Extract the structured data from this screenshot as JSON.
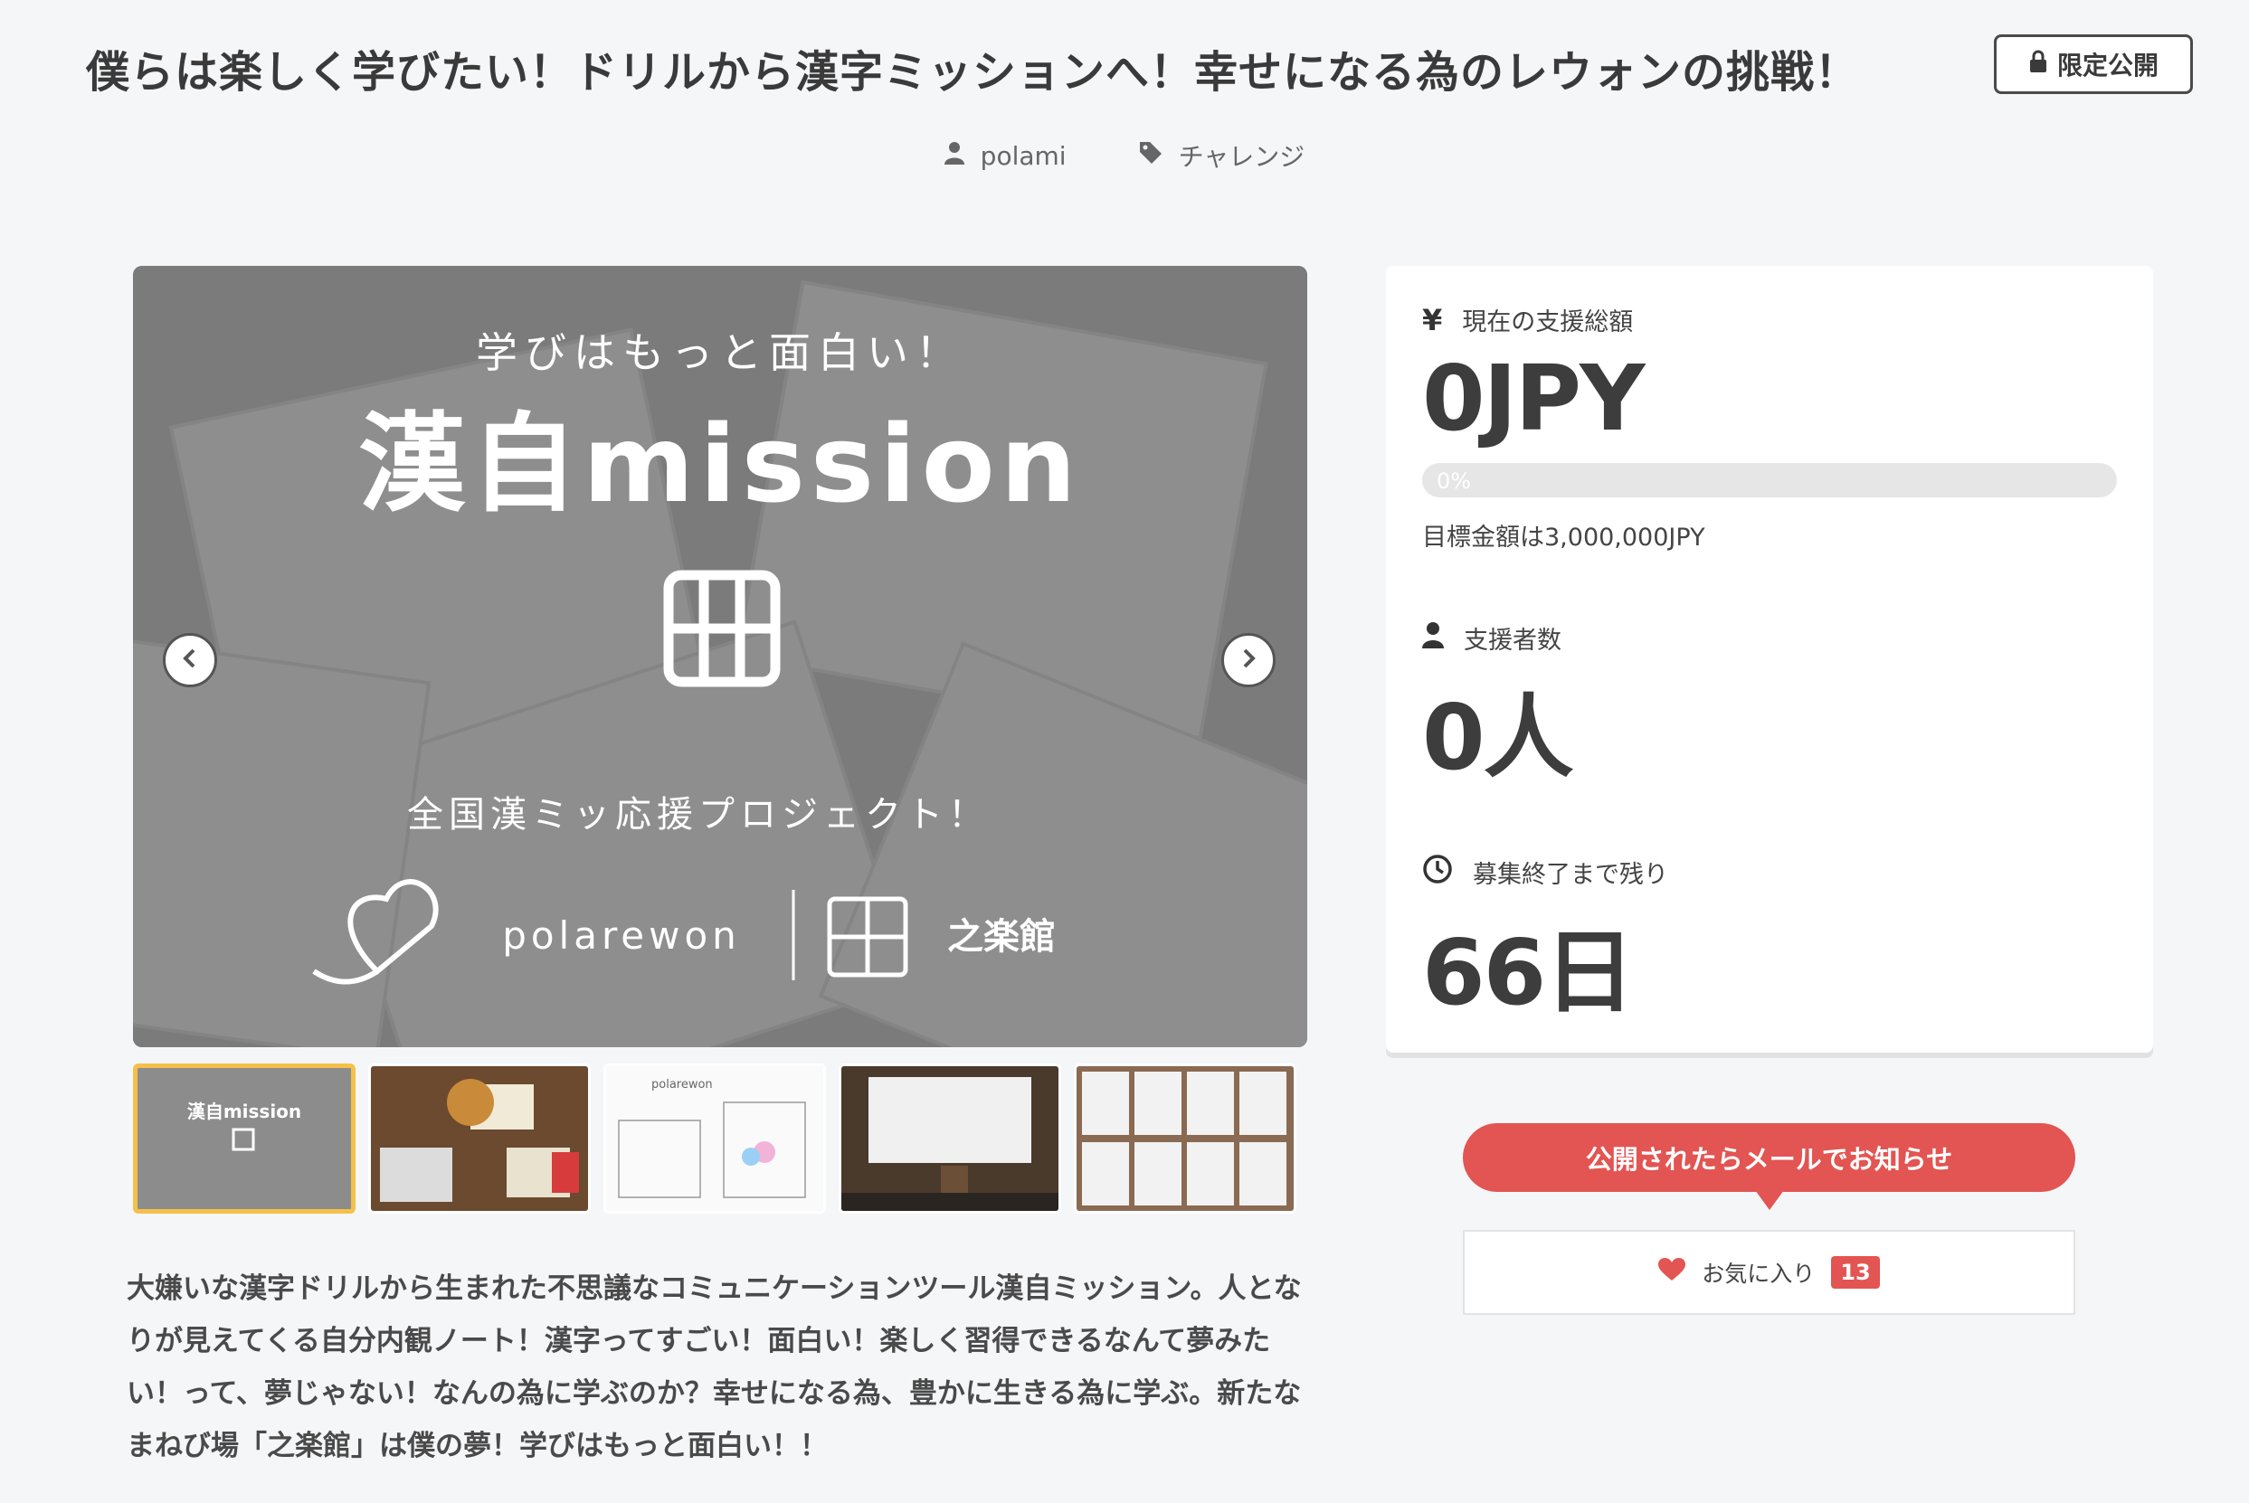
{
  "header": {
    "title": "僕らは楽しく学びたい！ドリルから漢字ミッションへ！幸せになる為のレウォンの挑戦！",
    "badge": "限定公開",
    "author": "polami",
    "category": "チャレンジ"
  },
  "gallery": {
    "main_image": {
      "tagline": "学びはもっと面白い！",
      "logo": "漢自mission",
      "subtitle": "全国漢ミッ応援プロジェクト！",
      "brand_left": "polarewon",
      "brand_right": "之楽館"
    },
    "thumbnails": [
      {
        "label": "漢自mission",
        "active": true
      },
      {
        "label": "",
        "active": false
      },
      {
        "label": "polarewon",
        "active": false
      },
      {
        "label": "",
        "active": false
      },
      {
        "label": "",
        "active": false
      }
    ]
  },
  "description": "大嫌いな漢字ドリルから生まれた不思議なコミュニケーションツール漢自ミッション。人となりが見えてくる自分内観ノート！漢字ってすごい！面白い！楽しく習得できるなんて夢みたい！って、夢じゃない！なんの為に学ぶのか？幸せになる為、豊かに生きる為に学ぶ。新たなまねび場「之楽館」は僕の夢！学びはもっと面白い！！",
  "stats": {
    "funding_label": "現在の支援総額",
    "funding_value": "0JPY",
    "progress_text": "0%",
    "progress_fraction": 0,
    "goal_text": "目標金額は3,000,000JPY",
    "supporters_label": "支援者数",
    "supporters_value": "0人",
    "remaining_label": "募集終了まで残り",
    "remaining_value": "66日"
  },
  "actions": {
    "notify_label": "公開されたらメールでお知らせ",
    "favorite_label": "お気に入り",
    "favorite_count": "13"
  },
  "colors": {
    "accent": "#e25552",
    "active_thumb_border": "#f5c04a",
    "background": "#f5f6f8"
  },
  "icons": {
    "badge": "lock-icon",
    "author": "user-icon",
    "category": "tag-icon",
    "funding": "yen-icon",
    "supporters": "user-icon",
    "remaining": "clock-icon",
    "favorite": "heart-icon",
    "prev": "chevron-left-icon",
    "next": "chevron-right-icon"
  }
}
